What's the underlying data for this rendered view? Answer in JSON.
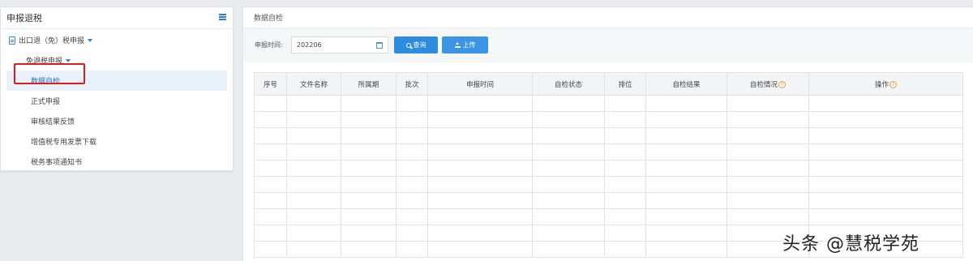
{
  "sidebar": {
    "title": "申报退税",
    "menu_icon": "hamburger-icon",
    "group": "出口退（免）税申报",
    "subgroup": "免退税申报",
    "items": [
      {
        "label": "数据自检",
        "active": true
      },
      {
        "label": "正式申报",
        "active": false
      },
      {
        "label": "审核结果反馈",
        "active": false
      },
      {
        "label": "增值税专用发票下载",
        "active": false
      },
      {
        "label": "税务事项通知书",
        "active": false
      }
    ]
  },
  "main": {
    "title": "数据自检",
    "filter": {
      "label": "申报时间:",
      "date_value": "202206",
      "query_button": "查询",
      "upload_button": "上传"
    },
    "table": {
      "columns": [
        "序号",
        "文件名称",
        "所属期",
        "批次",
        "申报时间",
        "自检状态",
        "排位",
        "自检结果",
        "自检情况",
        "操作"
      ],
      "help_icon": "?"
    }
  },
  "watermark": "头条 @慧税学苑",
  "colors": {
    "accent": "#2d8be0",
    "active_bg": "#e9f2fb",
    "highlight_box": "#e11c1c",
    "help_icon": "#e3a53b"
  }
}
